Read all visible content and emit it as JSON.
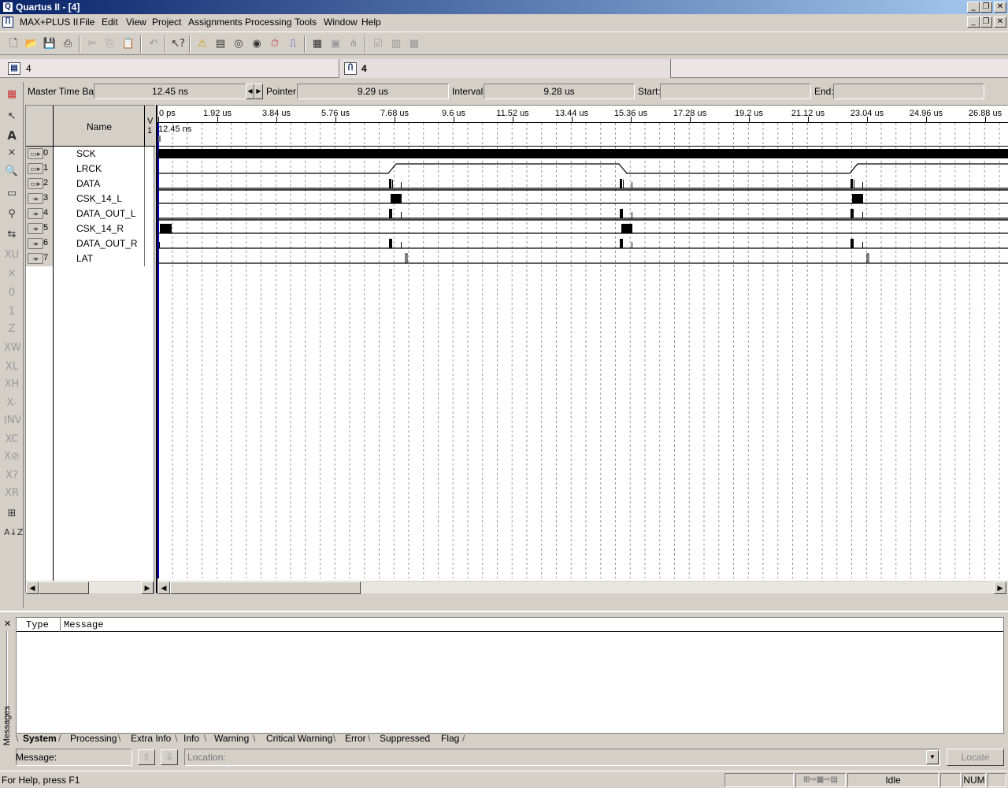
{
  "window": {
    "title": "Quartus II - [4]",
    "controls": [
      "_",
      "❐",
      "✕"
    ]
  },
  "menubar": {
    "items": [
      "MAX+PLUS II",
      "File",
      "Edit",
      "View",
      "Project",
      "Assignments",
      "Processing",
      "Tools",
      "Window",
      "Help"
    ]
  },
  "doc_tabs": {
    "left_label": "4",
    "right_label": "4"
  },
  "timebar": {
    "master_label": "Master Time Bar:",
    "master_value": "12.45 ns",
    "pointer_label": "Pointer:",
    "pointer_value": "9.29 us",
    "interval_label": "Interval:",
    "interval_value": "9.28 us",
    "start_label": "Start:",
    "start_value": "",
    "end_label": "End:",
    "end_value": ""
  },
  "name_pane": {
    "header": "Name",
    "value_header": "V",
    "value_sub": "1"
  },
  "signals": [
    {
      "index": "0",
      "name": "SCK",
      "dir": "in"
    },
    {
      "index": "1",
      "name": "LRCK",
      "dir": "in"
    },
    {
      "index": "2",
      "name": "DATA",
      "dir": "in"
    },
    {
      "index": "3",
      "name": "CSK_14_L",
      "dir": "out"
    },
    {
      "index": "4",
      "name": "DATA_OUT_L",
      "dir": "out"
    },
    {
      "index": "5",
      "name": "CSK_14_R",
      "dir": "out"
    },
    {
      "index": "6",
      "name": "DATA_OUT_R",
      "dir": "out"
    },
    {
      "index": "7",
      "name": "LAT",
      "dir": "out"
    }
  ],
  "ruler": {
    "ticks": [
      "0 ps",
      "1.92 us",
      "3.84 us",
      "5.76 us",
      "7.68 us",
      "9.6 us",
      "11.52 us",
      "13.44 us",
      "15.36 us",
      "17.28 us",
      "19.2 us",
      "21.12 us",
      "23.04 us",
      "24.96 us",
      "26.88 us"
    ],
    "master_marker": "12.45 ns"
  },
  "messages": {
    "columns": [
      "Type",
      "Message"
    ],
    "side_label": "Messages",
    "tabs": [
      "System",
      "Processing",
      "Extra Info",
      "Info",
      "Warning",
      "Critical Warning",
      "Error",
      "Suppressed",
      "Flag"
    ],
    "message_label": "Message:",
    "location_placeholder": "Location:",
    "locate_label": "Locate"
  },
  "statusbar": {
    "help": "For Help, press F1",
    "state": "Idle",
    "num": "NUM"
  },
  "colors": {
    "title_start": "#0a246a",
    "title_end": "#a6caf0",
    "face": "#d4d0c8"
  }
}
